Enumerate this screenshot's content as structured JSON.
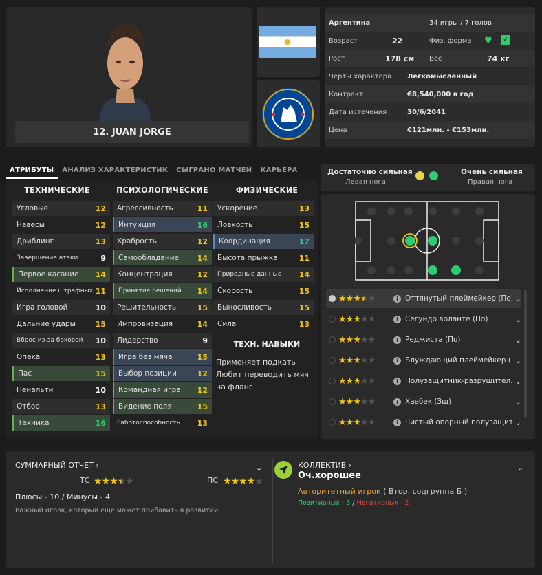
{
  "player": {
    "name": "12. JUAN JORGE"
  },
  "info": {
    "nation": "Аргентина",
    "caps": "34 игры / 7 голов",
    "age_label": "Возраст",
    "age": "22",
    "fitness_label": "Физ. форма",
    "height_label": "Рост",
    "height": "178 см",
    "weight_label": "Вес",
    "weight": "74 кг",
    "personality_label": "Черты характера",
    "personality": "Легкомысленный",
    "contract_label": "Контракт",
    "contract": "€8,540,000 в год",
    "expiry_label": "Дата истечения",
    "expiry": "30/6/2041",
    "value_label": "Цена",
    "value": "€121млн. - €153млн."
  },
  "tabs": [
    "АТРИБУТЫ",
    "АНАЛИЗ ХАРАКТЕРИСТИК",
    "СЫГРАНО МАТЧЕЙ",
    "КАРЬЕРА"
  ],
  "attributes": {
    "technical_title": "ТЕХНИЧЕСКИЕ",
    "mental_title": "ПСИХОЛОГИЧЕСКИЕ",
    "physical_title": "ФИЗИЧЕСКИЕ",
    "technical": [
      {
        "label": "Угловые",
        "value": "12"
      },
      {
        "label": "Навесы",
        "value": "12"
      },
      {
        "label": "Дриблинг",
        "value": "13"
      },
      {
        "label": "Завершение атаки",
        "value": "9"
      },
      {
        "label": "Первое касание",
        "value": "14"
      },
      {
        "label": "Исполнение штрафных",
        "value": "11"
      },
      {
        "label": "Игра головой",
        "value": "10"
      },
      {
        "label": "Дальние удары",
        "value": "15"
      },
      {
        "label": "Вброс из-за боковой",
        "value": "10"
      },
      {
        "label": "Опека",
        "value": "13"
      },
      {
        "label": "Пас",
        "value": "15"
      },
      {
        "label": "Пенальти",
        "value": "10"
      },
      {
        "label": "Отбор",
        "value": "13"
      },
      {
        "label": "Техника",
        "value": "16"
      }
    ],
    "mental": [
      {
        "label": "Агрессивность",
        "value": "11"
      },
      {
        "label": "Интуиция",
        "value": "16"
      },
      {
        "label": "Храбрость",
        "value": "12"
      },
      {
        "label": "Самообладание",
        "value": "14"
      },
      {
        "label": "Концентрация",
        "value": "12"
      },
      {
        "label": "Принятие решений",
        "value": "14"
      },
      {
        "label": "Решительность",
        "value": "15"
      },
      {
        "label": "Импровизация",
        "value": "14"
      },
      {
        "label": "Лидерство",
        "value": "9"
      },
      {
        "label": "Игра без мяча",
        "value": "15"
      },
      {
        "label": "Выбор позиции",
        "value": "12"
      },
      {
        "label": "Командная игра",
        "value": "12"
      },
      {
        "label": "Видение поля",
        "value": "15"
      },
      {
        "label": "Работоспособность",
        "value": "13"
      }
    ],
    "physical": [
      {
        "label": "Ускорение",
        "value": "13"
      },
      {
        "label": "Ловкость",
        "value": "15"
      },
      {
        "label": "Координация",
        "value": "17"
      },
      {
        "label": "Высота прыжка",
        "value": "11"
      },
      {
        "label": "Природные данные",
        "value": "14"
      },
      {
        "label": "Скорость",
        "value": "15"
      },
      {
        "label": "Выносливость",
        "value": "15"
      },
      {
        "label": "Сила",
        "value": "13"
      }
    ],
    "skills_title": "ТЕХН. НАВЫКИ",
    "skills": [
      "Применяет подкаты",
      "Любит переводить мяч на фланг"
    ]
  },
  "feet": {
    "left_strength": "Достаточно сильная",
    "left_label": "Левая нога",
    "right_strength": "Очень сильная",
    "right_label": "Правая нога",
    "left_color": "#e8d44d",
    "right_color": "#2ecc71"
  },
  "roles": [
    {
      "label": "Оттянутый плеймейкер (По)",
      "stars": 3.5
    },
    {
      "label": "Сегундо воланте (По)",
      "stars": 3
    },
    {
      "label": "Реджиста (По)",
      "stars": 3
    },
    {
      "label": "Блуждающий плеймейкер (...",
      "stars": 3
    },
    {
      "label": "Полузащитник-разрушител...",
      "stars": 3
    },
    {
      "label": "Хавбек (Зщ)",
      "stars": 3
    },
    {
      "label": "Чистый опорный полузащит...",
      "stars": 3
    }
  ],
  "report": {
    "title": "СУММАРНЫЙ ОТЧЕТ",
    "ca_label": "ТС",
    "ca_stars": 3.5,
    "pa_label": "ПС",
    "pa_stars": 4,
    "pros_cons": "Плюсы - 10 / Минусы - 4",
    "note": "Важный игрок, который еще может прибавить в развитии"
  },
  "team": {
    "title": "КОЛЛЕКТИВ",
    "status": "Оч.хорошее",
    "role": "Авторитетный игрок",
    "group": "( Втор. соцгруппа Б )",
    "positive": "Позитивных - 3",
    "sep": "/",
    "negative": "Негативных - 2"
  },
  "colors": {
    "accent_yellow": "#f1c40f",
    "accent_green": "#2ecc71",
    "negative_red": "#e74c3c",
    "orange": "#e0a040"
  }
}
